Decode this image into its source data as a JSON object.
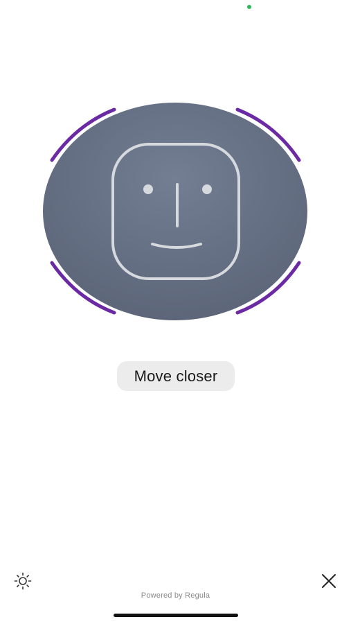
{
  "status": {
    "camera_indicator_color": "#2fb85a"
  },
  "face_capture": {
    "frame_accent_color": "#6b2aa3",
    "oval_color": "#6b7588",
    "face_outline_icon": "face-outline-icon",
    "hint_text": "Move closer"
  },
  "controls": {
    "torch_icon": "sun-icon",
    "close_icon": "close-icon"
  },
  "footer": {
    "powered_by_text": "Powered by Regula"
  }
}
